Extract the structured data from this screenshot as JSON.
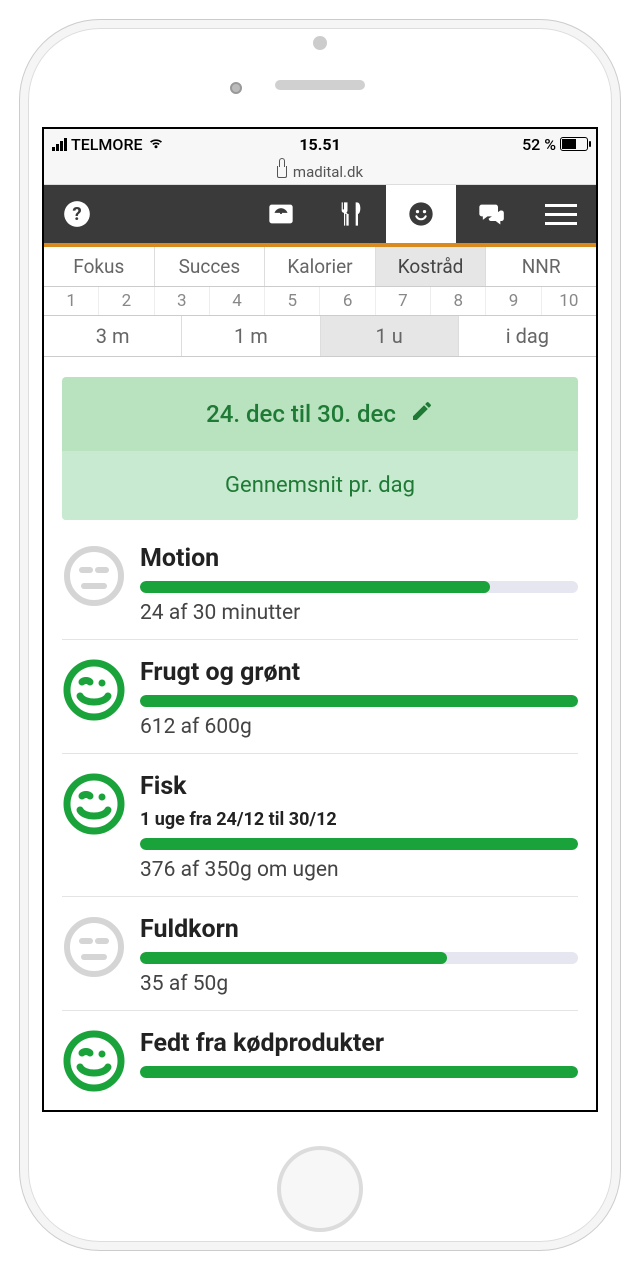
{
  "statusbar": {
    "carrier": "TELMORE",
    "time": "15.51",
    "battery_pct": "52 %"
  },
  "url": "madital.dk",
  "tabs": {
    "items": [
      "Fokus",
      "Succes",
      "Kalorier",
      "Kostråd",
      "NNR"
    ],
    "selected": 3
  },
  "numbers": [
    "1",
    "2",
    "3",
    "4",
    "5",
    "6",
    "7",
    "8",
    "9",
    "10"
  ],
  "ranges": {
    "items": [
      "3 m",
      "1 m",
      "1 u",
      "i dag"
    ],
    "selected": 2
  },
  "datecard": {
    "range": "24. dec til 30. dec",
    "avg_label": "Gennemsnit pr. dag"
  },
  "items": [
    {
      "title": "Motion",
      "sub": "",
      "detail": "24 af 30 minutter",
      "pct": 80,
      "mood": "neutral"
    },
    {
      "title": "Frugt og grønt",
      "sub": "",
      "detail": "612 af 600g",
      "pct": 100,
      "mood": "happy"
    },
    {
      "title": "Fisk",
      "sub": "1 uge fra 24/12 til 30/12",
      "detail": "376 af 350g om ugen",
      "pct": 100,
      "mood": "happy"
    },
    {
      "title": "Fuldkorn",
      "sub": "",
      "detail": "35 af 50g",
      "pct": 70,
      "mood": "neutral"
    },
    {
      "title": "Fedt fra kødprodukter",
      "sub": "",
      "detail": "",
      "pct": 100,
      "mood": "happy"
    }
  ]
}
